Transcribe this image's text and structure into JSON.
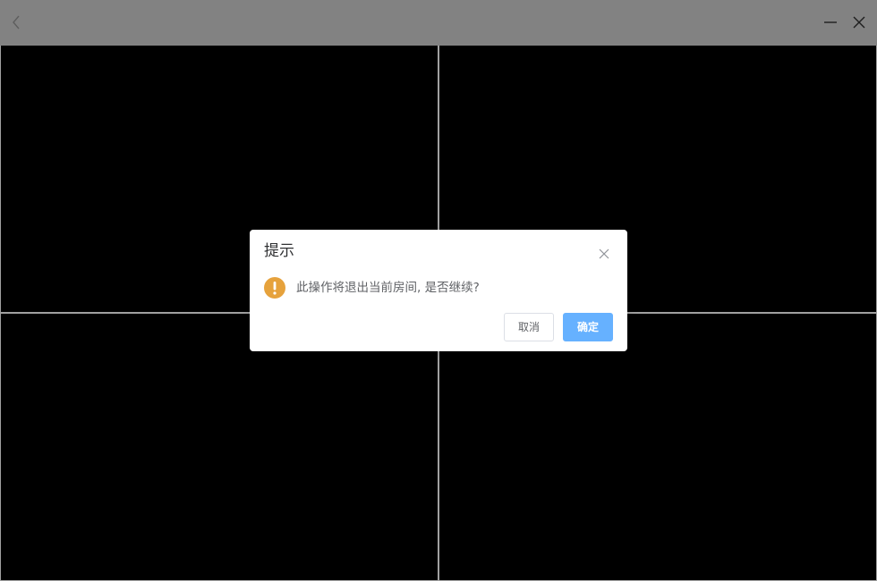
{
  "titlebar": {
    "back_icon": "chevron-left-icon",
    "minimize_icon": "minimize-icon",
    "close_icon": "close-icon"
  },
  "video_grid": {
    "tiles": [
      "",
      "",
      "",
      ""
    ]
  },
  "dialog": {
    "title": "提示",
    "message": "此操作将退出当前房间, 是否继续?",
    "icon": "warning-icon",
    "cancel_label": "取消",
    "confirm_label": "确定",
    "colors": {
      "warning": "#e6a23c",
      "primary": "#66b1ff",
      "text": "#606266",
      "title": "#303133"
    }
  }
}
